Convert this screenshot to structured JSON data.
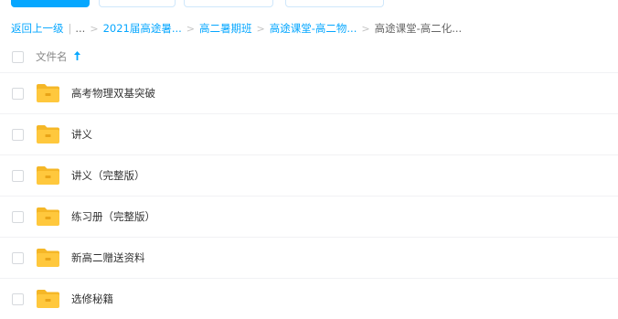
{
  "breadcrumb": {
    "back": "返回上一级",
    "ellipsis": "...",
    "crumbs": [
      {
        "label": "2021届高途暑..."
      },
      {
        "label": "高二暑期班"
      },
      {
        "label": "高途课堂-高二物..."
      }
    ],
    "current": "高途课堂-高二化...",
    "separator": ">",
    "divider": "|"
  },
  "list": {
    "header": {
      "column_label": "文件名",
      "sort_icon": "arrow-up-icon"
    },
    "rows": [
      {
        "name": "高考物理双基突破",
        "icon": "folder-icon"
      },
      {
        "name": "讲义",
        "icon": "folder-icon"
      },
      {
        "name": "讲义（完整版）",
        "icon": "folder-icon"
      },
      {
        "name": "练习册（完整版）",
        "icon": "folder-icon"
      },
      {
        "name": "新高二赠送资料",
        "icon": "folder-icon"
      },
      {
        "name": "选修秘籍",
        "icon": "folder-icon"
      }
    ]
  },
  "colors": {
    "accent": "#06a7ff",
    "folder": "#ffc83d",
    "folder_back": "#f5b727",
    "text": "#333333",
    "muted": "#888888"
  }
}
